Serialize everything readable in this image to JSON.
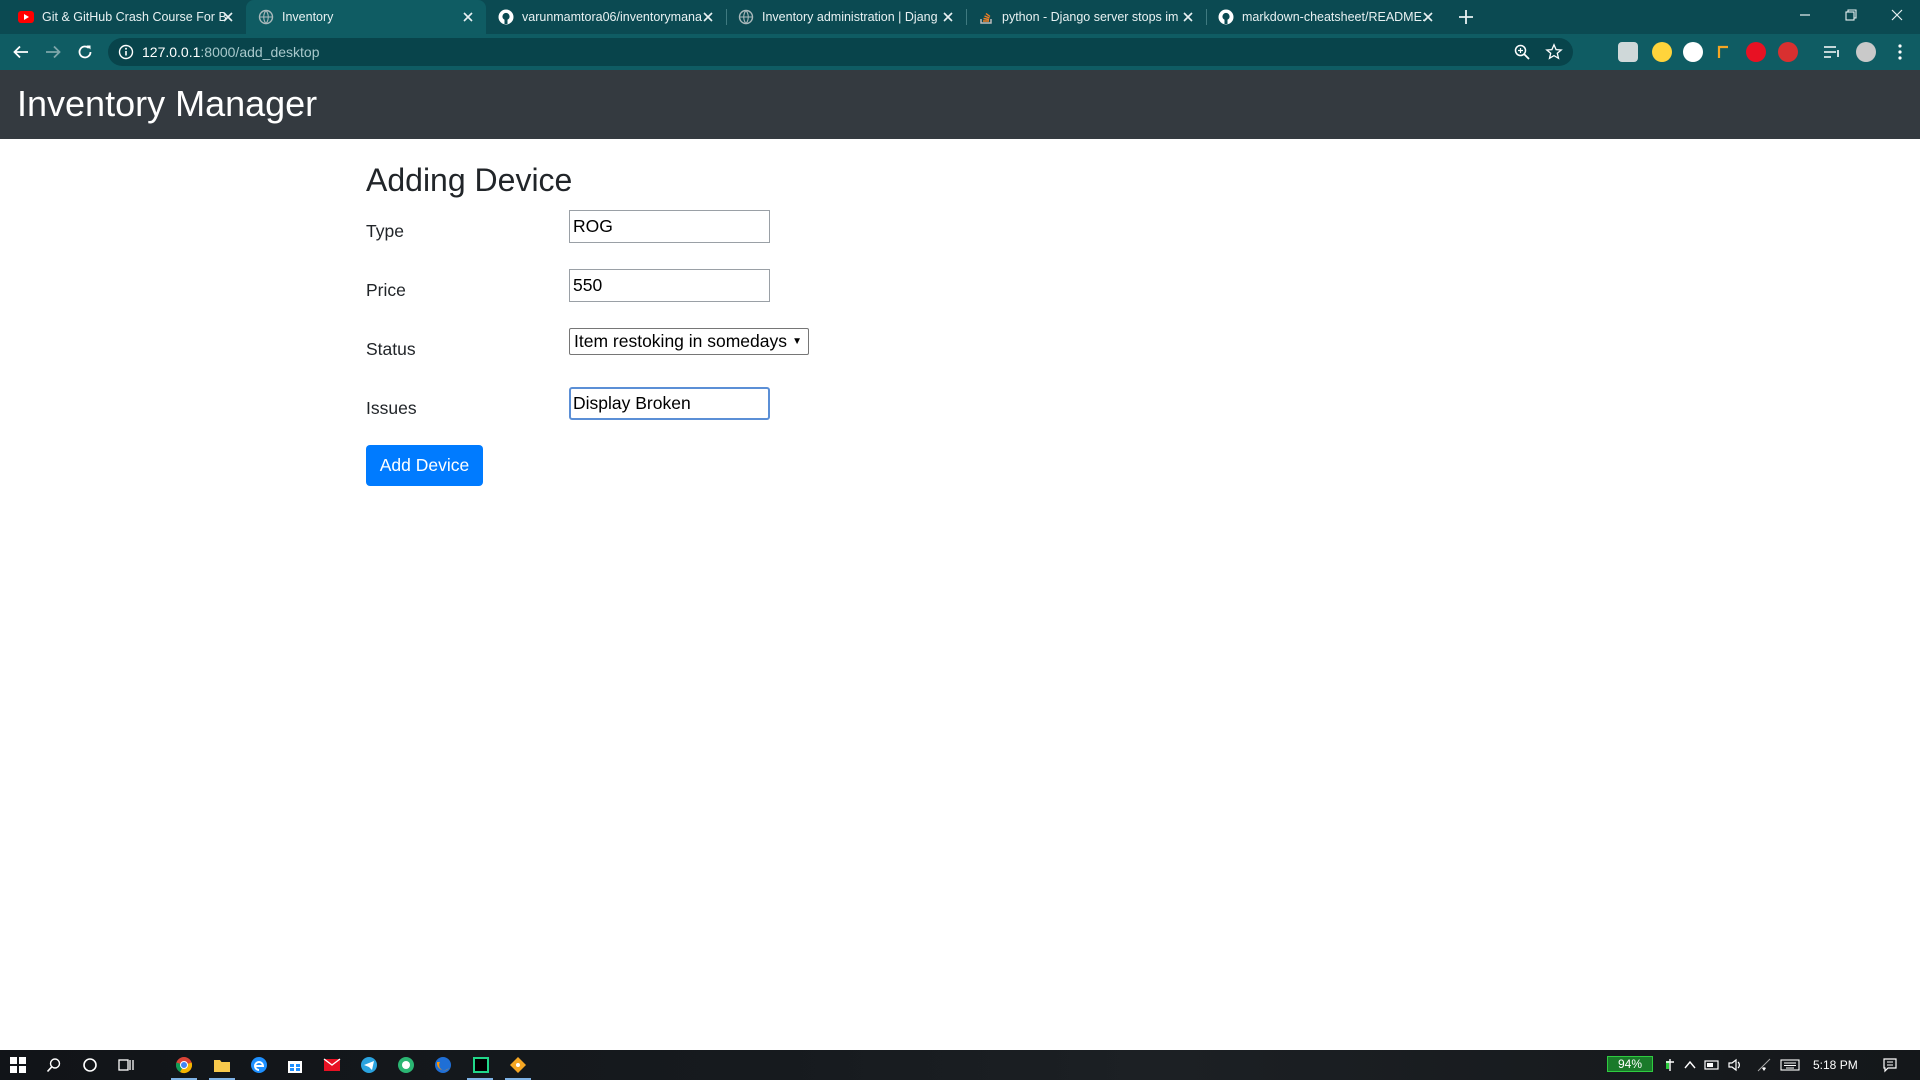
{
  "browser": {
    "tabs": [
      {
        "title": "Git & GitHub Crash Course For B",
        "icon": "youtube-icon",
        "active": false
      },
      {
        "title": "Inventory",
        "icon": "globe-icon",
        "active": true
      },
      {
        "title": "varunmamtora06/inventorymana",
        "icon": "github-icon",
        "active": false
      },
      {
        "title": "Inventory administration | Djang",
        "icon": "globe-icon",
        "active": false
      },
      {
        "title": "python - Django server stops im",
        "icon": "stackoverflow-icon",
        "active": false
      },
      {
        "title": "markdown-cheatsheet/README.",
        "icon": "github-icon",
        "active": false
      }
    ],
    "address": {
      "host": "127.0.0.1",
      "path": ":8000/add_desktop"
    }
  },
  "app": {
    "brand": "Inventory Manager"
  },
  "form": {
    "heading": "Adding Device",
    "type": {
      "label": "Type",
      "value": "ROG"
    },
    "price": {
      "label": "Price",
      "value": "550"
    },
    "status": {
      "label": "Status",
      "value": "Item restoking in somedays"
    },
    "issues": {
      "label": "Issues",
      "value": "Display Broken"
    },
    "submit_label": "Add Device"
  },
  "taskbar": {
    "battery": "94%",
    "time": "5:18 PM"
  },
  "colors": {
    "tab_strip": "#0b4a52",
    "toolbar": "#0f5c63",
    "navbar": "#343a40",
    "primary_button": "#007bff"
  }
}
